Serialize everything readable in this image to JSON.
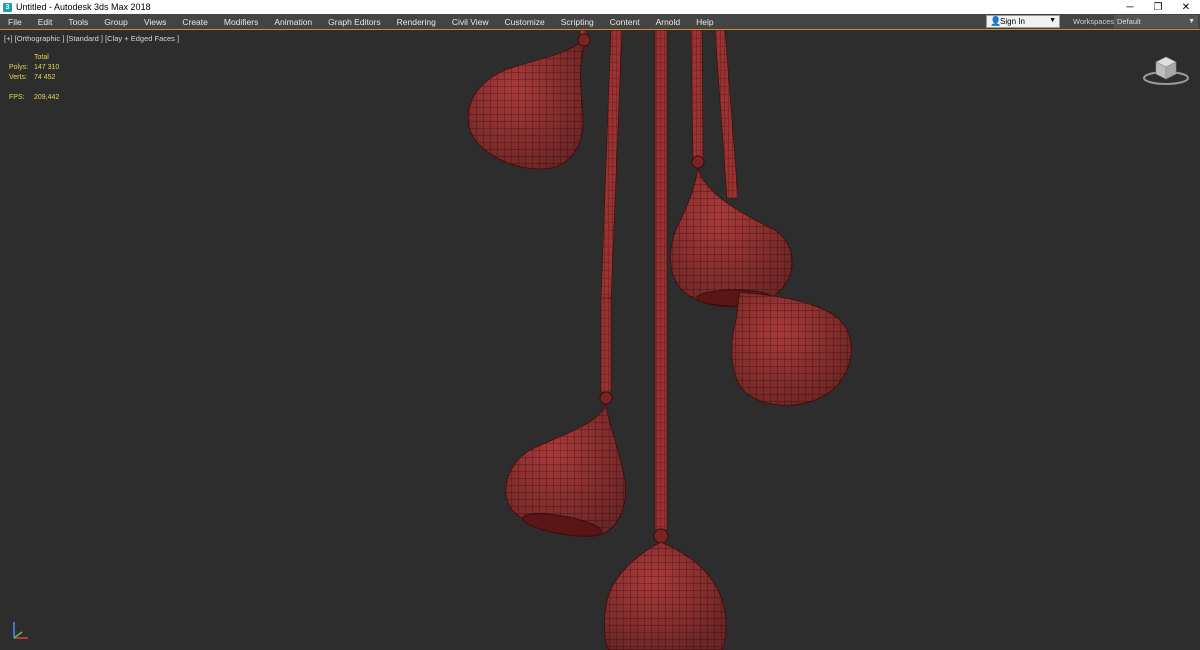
{
  "window": {
    "title": "Untitled - Autodesk 3ds Max 2018",
    "app_icon": "3ds-max-icon",
    "minimize": "─",
    "restore": "❐",
    "close": "✕"
  },
  "menu": {
    "items": [
      "File",
      "Edit",
      "Tools",
      "Group",
      "Views",
      "Create",
      "Modifiers",
      "Animation",
      "Graph Editors",
      "Rendering",
      "Civil View",
      "Customize",
      "Scripting",
      "Content",
      "Arnold",
      "Help"
    ],
    "sign_in": "Sign In",
    "workspaces_label": "Workspaces:",
    "workspace_value": "Default"
  },
  "viewport": {
    "label": "[+] [Orthographic ] [Standard ] [Clay + Edged Faces ]",
    "stats": {
      "header": "Total",
      "polys_label": "Polys:",
      "polys_value": "147 310",
      "verts_label": "Verts:",
      "verts_value": "74 452",
      "fps_label": "FPS:",
      "fps_value": "209,442"
    }
  },
  "colors": {
    "clay": "#a83a3a",
    "wire": "#4a1212",
    "background": "#2d2d2d",
    "menu_bg": "#444444",
    "stats_text": "#e8d64a"
  }
}
